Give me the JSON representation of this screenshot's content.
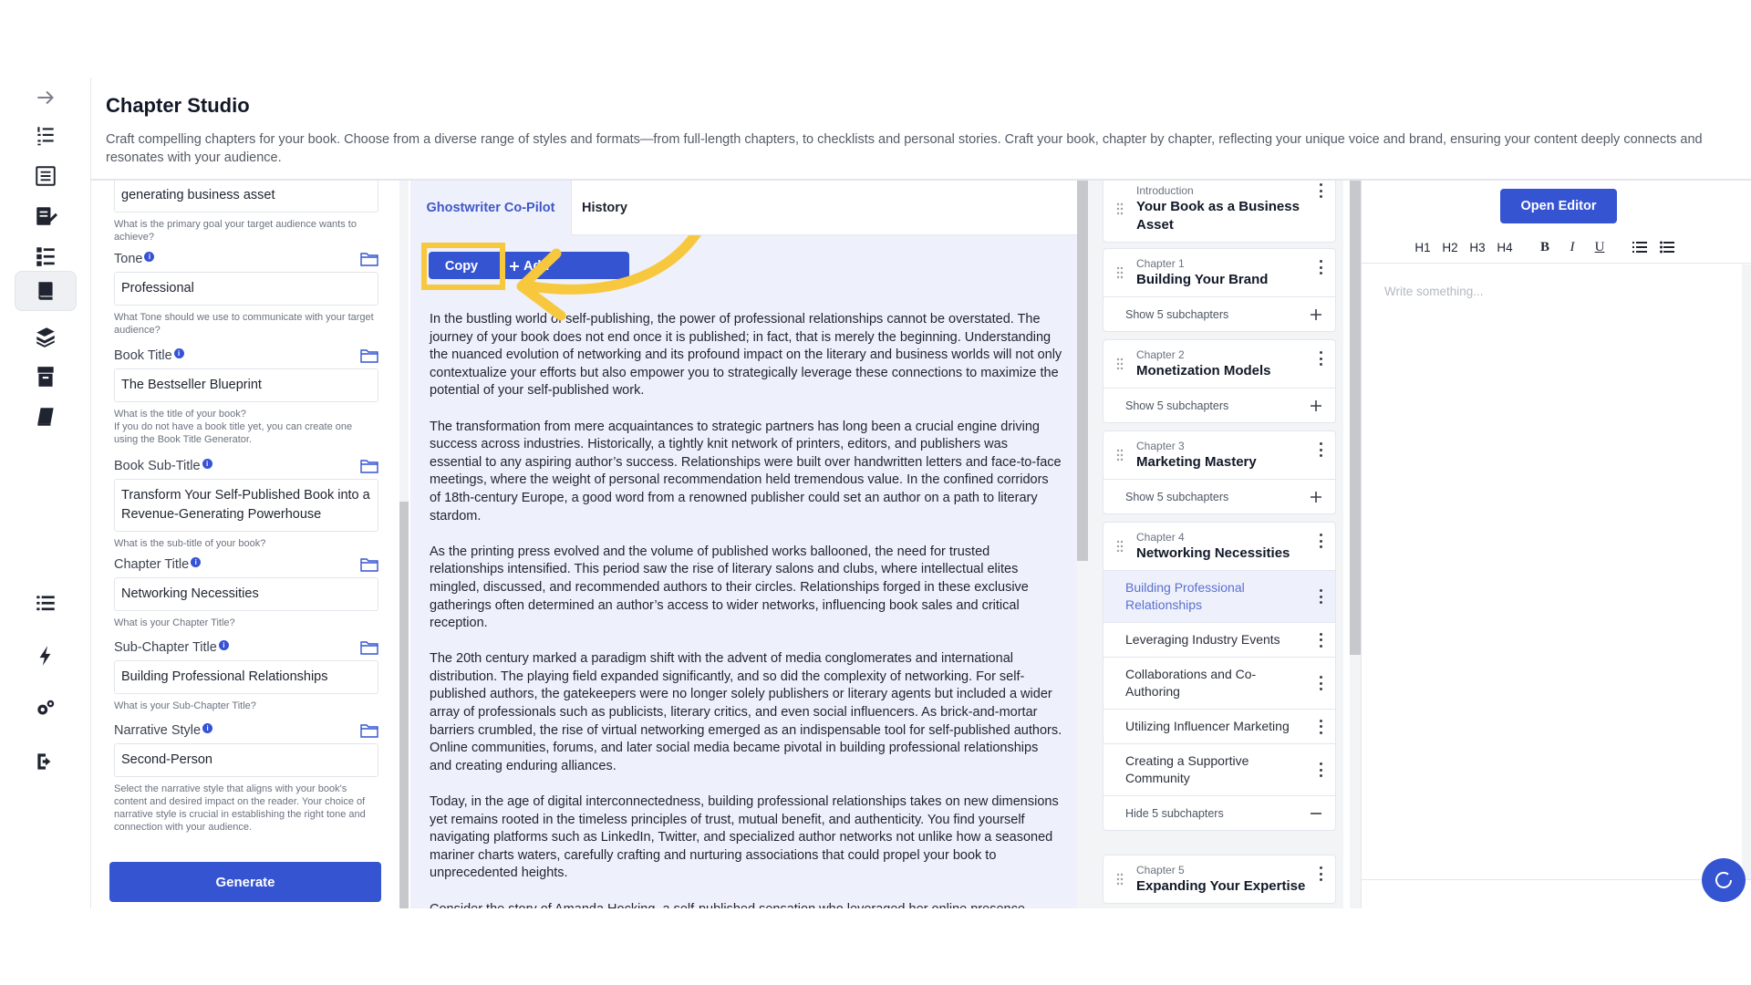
{
  "header": {
    "title": "Chapter Studio",
    "description": "Craft compelling chapters for your book. Choose from a diverse range of styles and formats—from full-length chapters, to checklists and personal stories. Craft your book, chapter by chapter, reflecting your unique voice and brand, ensuring your content deeply connects and resonates with your audience."
  },
  "rail": {
    "icons": [
      "arrow-right-icon",
      "numbered-list-icon",
      "outline-icon",
      "edit-document-icon",
      "task-list-icon",
      "book-studio-icon",
      "books-stack-icon",
      "archive-icon",
      "book-icon",
      "list-icon",
      "bolt-icon",
      "settings-icon",
      "logout-icon"
    ]
  },
  "form": {
    "goal": {
      "value": "generating business asset",
      "hint": "What is the primary goal your target audience wants to achieve?"
    },
    "tone": {
      "label": "Tone",
      "value": "Professional",
      "hint": "What Tone should we use to communicate with your target audience?"
    },
    "book_title": {
      "label": "Book Title",
      "value": "The Bestseller Blueprint",
      "hint": "What is the title of your book?",
      "hint2": "If you do not have a book title yet, you can create one using the Book Title Generator."
    },
    "book_subtitle": {
      "label": "Book Sub-Title",
      "value": "Transform Your Self-Published Book into a Revenue-Generating Powerhouse",
      "hint": "What is the sub-title of your book?"
    },
    "chapter_title": {
      "label": "Chapter Title",
      "value": "Networking Necessities",
      "hint": "What is your Chapter Title?"
    },
    "subchapter_title": {
      "label": "Sub-Chapter Title",
      "value": "Building Professional Relationships",
      "hint": "What is your Sub-Chapter Title?"
    },
    "narrative_style": {
      "label": "Narrative Style",
      "value": "Second-Person",
      "hint": "Select the narrative style that aligns with your book's content and desired impact on the reader. Your choice of narrative style is crucial in establishing the right tone and connection with your audience."
    },
    "info_glyph": "i",
    "generate_label": "Generate"
  },
  "copilot": {
    "tab_ghostwriter": "Ghostwriter Co-Pilot",
    "tab_history": "History",
    "copy_label": "Copy",
    "add_label": "Add",
    "paragraphs": [
      "In the bustling world of self-publishing, the power of professional relationships cannot be overstated. The journey of your book does not end once it is published; in fact, that is merely the beginning. Understanding the nuanced evolution of networking and its profound impact on the literary and business worlds will not only contextualize your efforts but also empower you to strategically leverage these connections to maximize the potential of your self-published work.",
      "The transformation from mere acquaintances to strategic partners has long been a crucial engine driving success across industries. Historically, a tightly knit network of printers, editors, and publishers was essential to any aspiring author’s success. Relationships were built over handwritten letters and face-to-face meetings, where the weight of personal recommendation held tremendous value. In the confined corridors of 18th-century Europe, a good word from a renowned publisher could set an author on a path to literary stardom.",
      "As the printing press evolved and the volume of published works ballooned, the need for trusted relationships intensified. This period saw the rise of literary salons and clubs, where intellectual elites mingled, discussed, and recommended authors to their circles. Relationships forged in these exclusive gatherings often determined an author’s access to wider networks, influencing book sales and critical reception.",
      "The 20th century marked a paradigm shift with the advent of media conglomerates and international distribution. The playing field expanded significantly, and so did the complexity of networking. For self-published authors, the gatekeepers were no longer solely publishers or literary agents but included a wider array of professionals such as publicists, literary critics, and even social influencers. As brick-and-mortar barriers crumbled, the rise of virtual networking emerged as an indispensable tool for self-published authors. Online communities, forums, and later social media became pivotal in building professional relationships and creating enduring alliances.",
      "Today, in the age of digital interconnectedness, building professional relationships takes on new dimensions yet remains rooted in the timeless principles of trust, mutual benefit, and authenticity. You find yourself navigating platforms such as LinkedIn, Twitter, and specialized author networks not unlike how a seasoned mariner charts waters, carefully crafting and nurturing associations that could propel your book to unprecedented heights.",
      "Consider the story of Amanda Hocking, a self-published sensation who leveraged her online presence"
    ]
  },
  "outline": {
    "intro": {
      "number": "Introduction",
      "title": "Your Book as a Business Asset"
    },
    "ch1": {
      "number": "Chapter 1",
      "title": "Building Your Brand",
      "toggle": "Show 5 subchapters"
    },
    "ch2": {
      "number": "Chapter 2",
      "title": "Monetization Models",
      "toggle": "Show 5 subchapters"
    },
    "ch3": {
      "number": "Chapter 3",
      "title": "Marketing Mastery",
      "toggle": "Show 5 subchapters"
    },
    "ch4": {
      "number": "Chapter 4",
      "title": "Networking Necessities",
      "subchapters": [
        "Building Professional Relationships",
        "Leveraging Industry Events",
        "Collaborations and Co-Authoring",
        "Utilizing Influencer Marketing",
        "Creating a Supportive Community"
      ],
      "toggle": "Hide 5 subchapters"
    },
    "ch5": {
      "number": "Chapter 5",
      "title": "Expanding Your Expertise"
    }
  },
  "editor": {
    "open_label": "Open Editor",
    "toolbar": {
      "h1": "H1",
      "h2": "H2",
      "h3": "H3",
      "h4": "H4",
      "bold": "B",
      "italic": "I",
      "underline": "U"
    },
    "placeholder": "Write something..."
  },
  "colors": {
    "primary": "#3554d1",
    "highlight": "#f7c83e",
    "tab_active_text": "#3f56c8"
  }
}
